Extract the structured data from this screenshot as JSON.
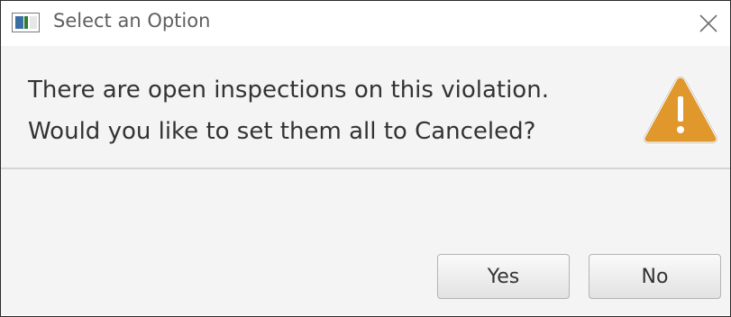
{
  "window": {
    "title": "Select an Option",
    "app_icon": "app-window-icon",
    "close_icon": "close-icon"
  },
  "message": {
    "line1": "There are open inspections on this violation.",
    "line2": "Would you like to set them all to Canceled?",
    "icon": "warning-icon",
    "icon_color": "#E0972B"
  },
  "buttons": {
    "yes_label": "Yes",
    "no_label": "No"
  }
}
